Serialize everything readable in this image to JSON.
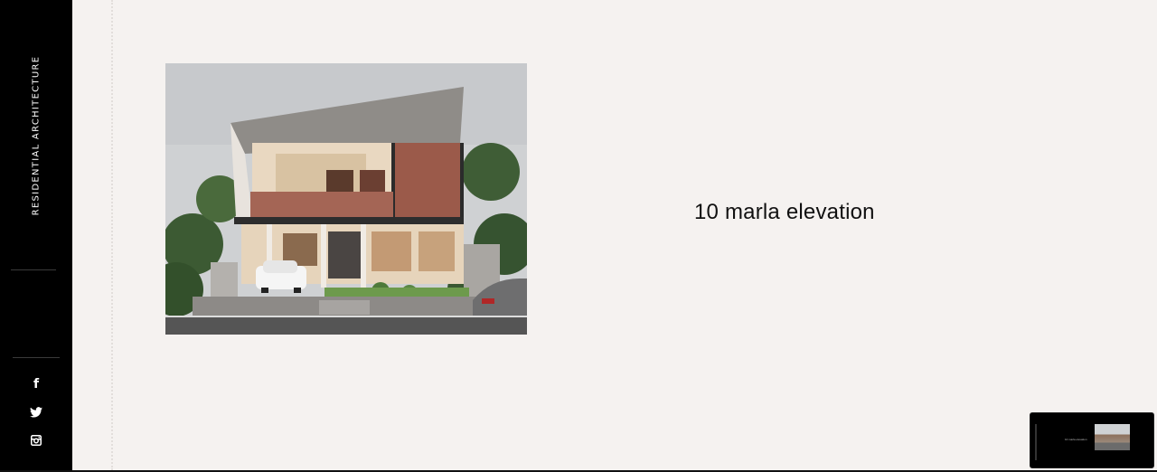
{
  "sidebar": {
    "brand": "RESIDENTIAL ARCHITECTURE",
    "social": [
      {
        "icon": "facebook-icon",
        "glyph": "f"
      },
      {
        "icon": "twitter-icon",
        "glyph": "🐦"
      },
      {
        "icon": "instagram-icon",
        "glyph": "◎"
      }
    ]
  },
  "content": {
    "caption": "10 marla elevation",
    "image_alt": "10 marla house elevation render"
  },
  "colors": {
    "sidebar_bg": "#000000",
    "page_bg": "#f5f2f0",
    "text": "#111111"
  }
}
